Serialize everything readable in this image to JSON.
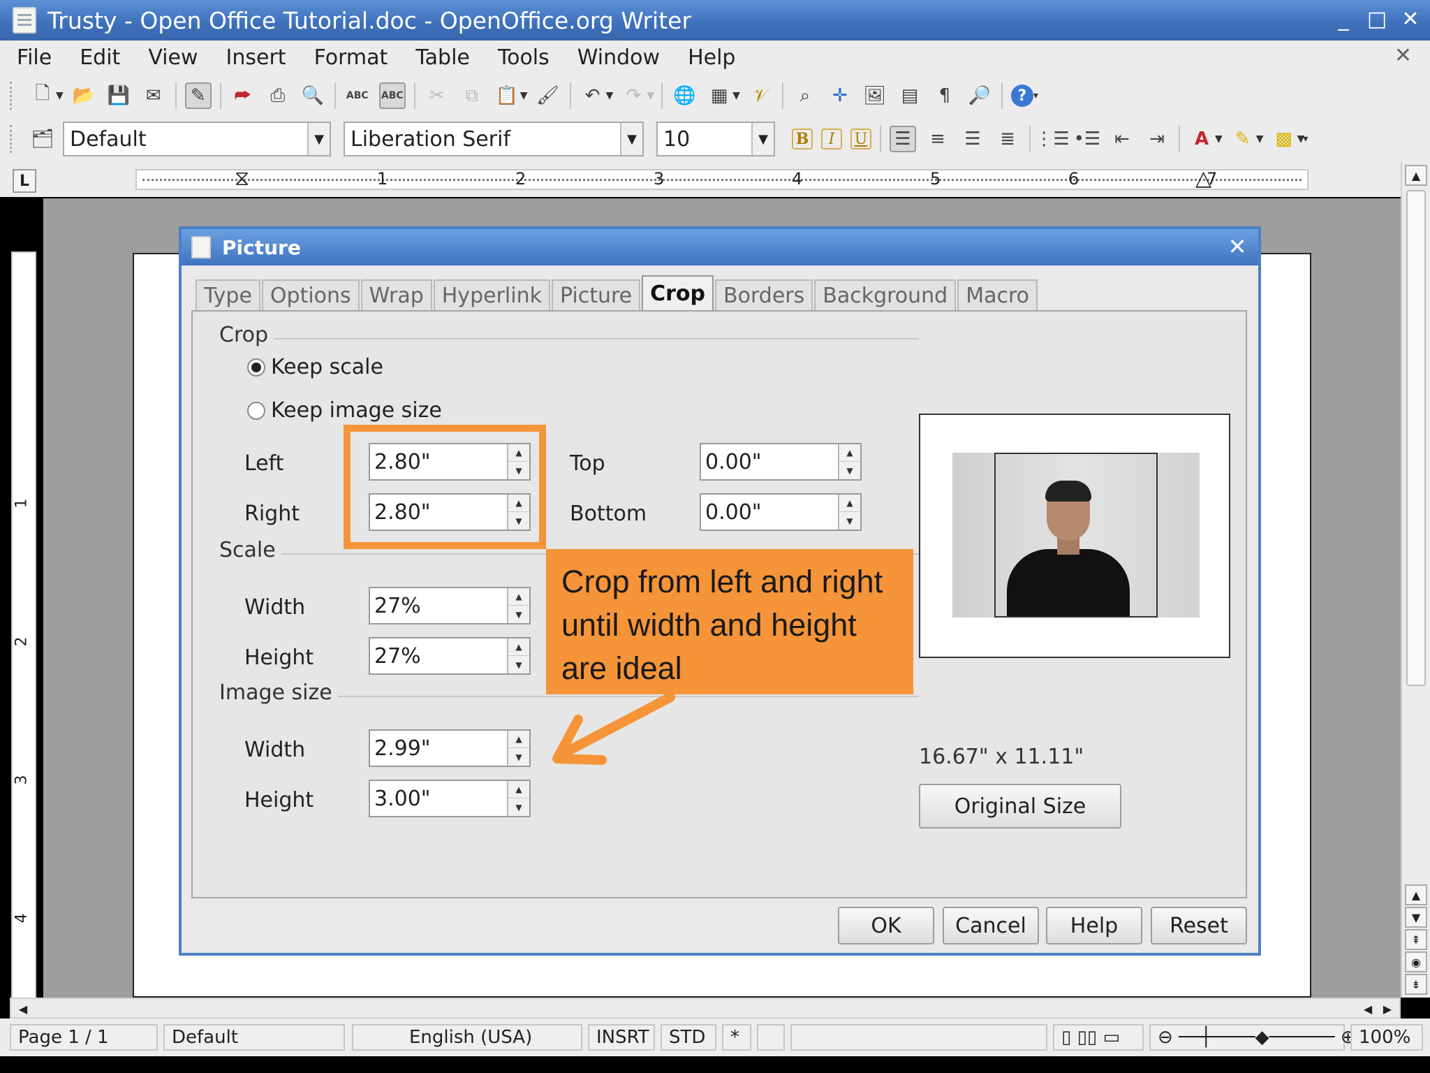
{
  "window": {
    "title": "Trusty - Open Office Tutorial.doc - OpenOffice.org Writer",
    "minimize": "_",
    "maximize": "□",
    "close": "✕"
  },
  "menubar": {
    "items": [
      "File",
      "Edit",
      "View",
      "Insert",
      "Format",
      "Table",
      "Tools",
      "Window",
      "Help"
    ],
    "close_doc": "✕"
  },
  "formatting": {
    "style": "Default",
    "font": "Liberation Serif",
    "size": "10",
    "bold": "B",
    "italic": "I",
    "underline": "U"
  },
  "ruler": {
    "corner": "L",
    "numbers": [
      "1",
      "2",
      "3",
      "4",
      "5",
      "6",
      "7"
    ],
    "vertical_numbers": [
      "1",
      "2",
      "3",
      "4"
    ]
  },
  "dialog": {
    "title": "Picture",
    "close": "✕",
    "tabs": [
      "Type",
      "Options",
      "Wrap",
      "Hyperlink",
      "Picture",
      "Crop",
      "Borders",
      "Background",
      "Macro"
    ],
    "active_tab": "Crop",
    "crop": {
      "group_label": "Crop",
      "keep_scale_label": "Keep scale",
      "keep_image_size_label": "Keep image size",
      "selected_mode": "keep_scale",
      "left_label": "Left",
      "left_value": "2.80\"",
      "right_label": "Right",
      "right_value": "2.80\"",
      "top_label": "Top",
      "top_value": "0.00\"",
      "bottom_label": "Bottom",
      "bottom_value": "0.00\""
    },
    "scale": {
      "group_label": "Scale",
      "width_label": "Width",
      "width_value": "27%",
      "height_label": "Height",
      "height_value": "27%"
    },
    "image_size": {
      "group_label": "Image size",
      "width_label": "Width",
      "width_value": "2.99\"",
      "height_label": "Height",
      "height_value": "3.00\""
    },
    "original_dimensions": "16.67\" x 11.11\"",
    "original_size_button": "Original Size",
    "buttons": {
      "ok": "OK",
      "cancel": "Cancel",
      "help": "Help",
      "reset": "Reset"
    }
  },
  "callout": {
    "text": "Crop from left and right until width and height are ideal",
    "color": "#f59438"
  },
  "statusbar": {
    "page": "Page 1 / 1",
    "style": "Default",
    "language": "English (USA)",
    "insert_mode": "INSRT",
    "selection_mode": "STD",
    "modified": "*",
    "zoom": "100%"
  },
  "colors": {
    "titlebar": "#3f72bb",
    "dialog_border": "#4b80c4",
    "highlight": "#f59438"
  }
}
